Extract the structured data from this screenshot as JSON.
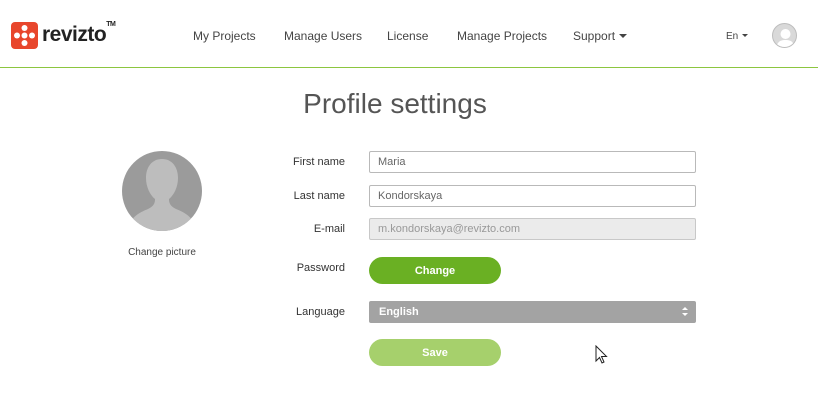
{
  "header": {
    "logo_text": "revizto",
    "logo_tm": "TM",
    "nav": [
      "My Projects",
      "Manage Users",
      "License",
      "Manage Projects",
      "Support"
    ],
    "language_short": "En"
  },
  "page_title": "Profile settings",
  "avatar": {
    "change_label": "Change picture"
  },
  "form": {
    "first_name_label": "First name",
    "first_name_value": "Maria",
    "last_name_label": "Last name",
    "last_name_value": "Kondorskaya",
    "email_label": "E-mail",
    "email_value": "m.kondorskaya@revizto.com",
    "password_label": "Password",
    "change_button": "Change",
    "language_label": "Language",
    "language_value": "English",
    "save_button": "Save"
  },
  "colors": {
    "accent_green": "#6ab023",
    "save_green_disabled": "#a6d06c",
    "logo_red": "#e8462c",
    "header_rule": "#8cc63f"
  }
}
